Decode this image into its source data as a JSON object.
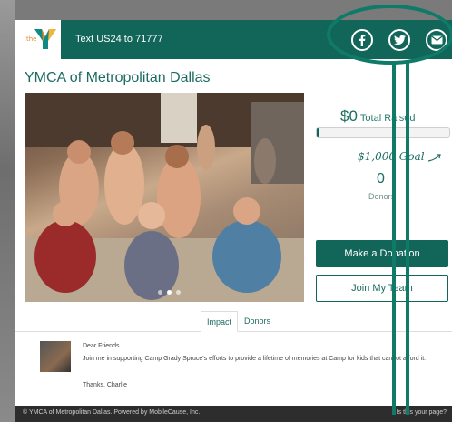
{
  "header": {
    "logo_text": "the",
    "text_line": "Text US24 to 71777",
    "social": [
      {
        "icon": "facebook-icon"
      },
      {
        "icon": "twitter-icon"
      },
      {
        "icon": "mail-icon"
      }
    ]
  },
  "org": {
    "title": "YMCA of Metropolitan Dallas"
  },
  "carousel": {
    "slides": 3,
    "active_index": 1
  },
  "fundraising": {
    "raised_amount": "$0",
    "raised_label": "Total Raised",
    "progress_fraction": 0.02,
    "goal_text": "$1,000  Goal",
    "donors_count": "0",
    "donors_label": "Donors"
  },
  "buttons": {
    "donate_label": "Make a Donation",
    "join_label": "Join My Team"
  },
  "tabs": [
    {
      "label": "Impact"
    },
    {
      "label": "Donors"
    }
  ],
  "update": {
    "greeting": "Dear Friends",
    "message": "Join me in supporting Camp Grady Spruce's efforts to provide a lifetime of memories at Camp for kids that cannot afford it.",
    "signoff": "Thanks, Charlie"
  },
  "footer": {
    "left": "© YMCA of Metropolitan Dallas. Powered by MobileCause, Inc.",
    "right": "Is this your page?"
  },
  "colors": {
    "brand": "#116659",
    "annotation": "#0f7a68"
  }
}
